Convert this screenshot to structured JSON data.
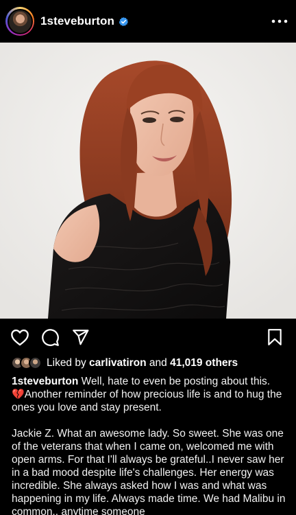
{
  "post": {
    "username": "1steveburton",
    "verified": true
  },
  "header": {
    "more_label": "•••",
    "avatar_icon": "profile-photo",
    "verified_icon": "verified-badge-icon"
  },
  "actions": {
    "like_icon": "heart-icon",
    "comment_icon": "comment-icon",
    "share_icon": "send-icon",
    "save_icon": "bookmark-icon"
  },
  "likes": {
    "prefix": "Liked by ",
    "liker": "carlivatiron",
    "middle": " and ",
    "count": "41,019 others"
  },
  "caption": {
    "username": "1steveburton",
    "line1": " Well, hate to even be posting about this. ",
    "emoji": "💔",
    "line1_rest": "Another reminder of how precious life is and to hug the ones you love and stay present.",
    "para2": "Jackie Z. What an awesome lady. So sweet. She was one of the veterans that when I came on, welcomed me with open arms. For that I'll always be grateful..I never saw her in a bad mood despite life's challenges. Her energy was incredible.  She always asked how I was and what was happening in my life. Always made time. We had Malibu in common.. anytime someone"
  },
  "colors": {
    "background": "#000000",
    "verified_blue": "#3897f0",
    "broken_heart": "#e0245e",
    "photo_bg": "#eeece9",
    "hair": "#8e3b1f",
    "dress": "#141212"
  }
}
